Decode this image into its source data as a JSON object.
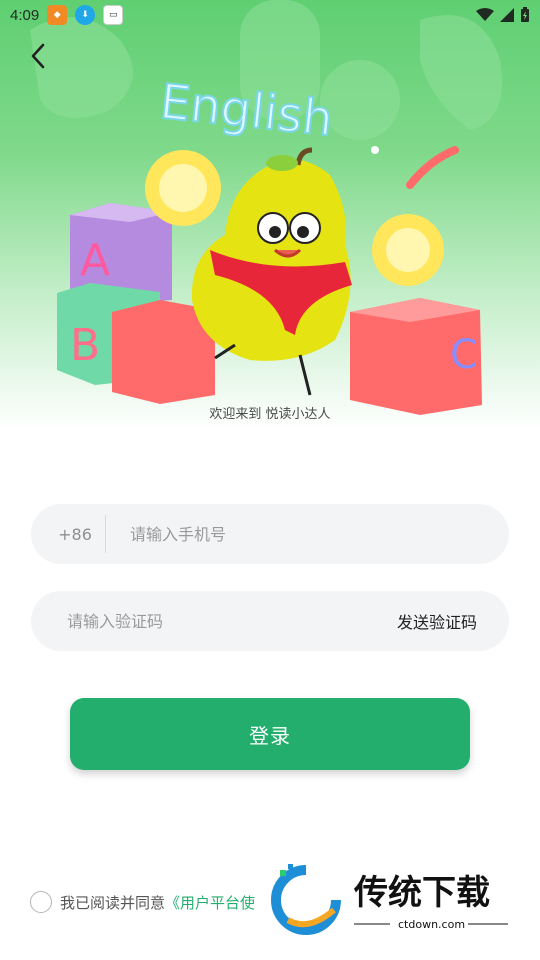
{
  "status_bar": {
    "time": "4:09",
    "icons": [
      "app-notification-icon",
      "download-icon",
      "app-notification-icon-2",
      "wifi-icon",
      "signal-icon",
      "battery-charging-icon"
    ]
  },
  "hero": {
    "title_art": "English",
    "cubes": [
      "A",
      "B",
      "C"
    ],
    "welcome_text": "欢迎来到 悦读小达人"
  },
  "form": {
    "phone_prefix": "+86",
    "phone_placeholder": "请输入手机号",
    "code_placeholder": "请输入验证码",
    "send_code_label": "发送验证码",
    "login_label": "登录"
  },
  "agreement": {
    "text": "我已阅读并同意",
    "link_text": "《用户平台使"
  },
  "watermark": {
    "brand": "传统下载",
    "url": "ctdown.com"
  },
  "colors": {
    "primary": "#23ae6d",
    "hero_green": "#5fcf72",
    "field_bg": "#f3f4f6"
  }
}
